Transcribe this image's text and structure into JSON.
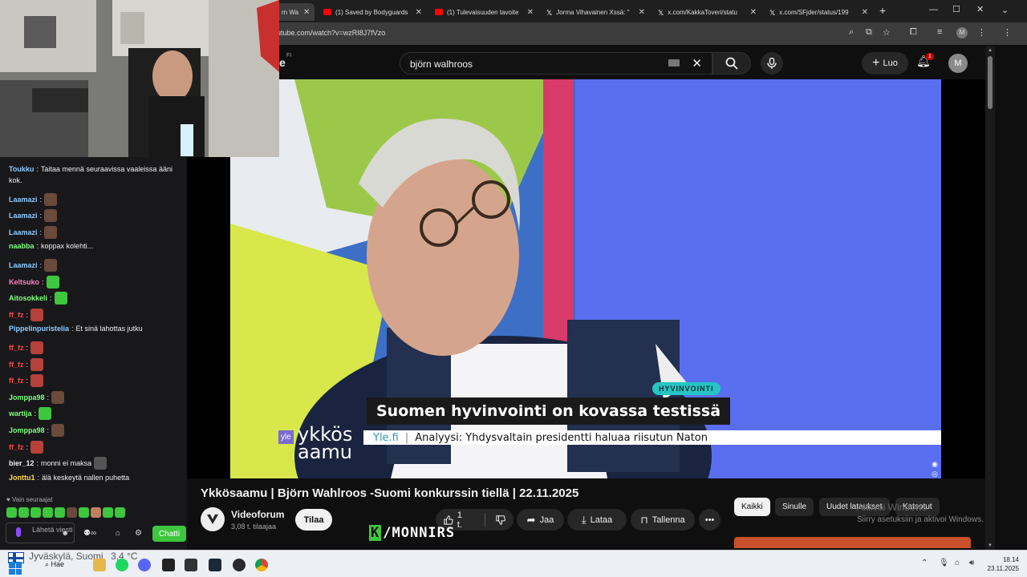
{
  "browser": {
    "tabs": [
      {
        "label": "rn Wa",
        "active": true,
        "color": "#ff0000"
      },
      {
        "label": "(1) Saved by Bodyguards",
        "color": "#ff0000"
      },
      {
        "label": "(1) Tulevaisuuden tavoite",
        "color": "#ff0000"
      },
      {
        "label": "Jorma Vihavainen Xssä: \"",
        "color": "#ffffff"
      },
      {
        "label": "x.com/KakkaToveri/statu",
        "color": "#ffffff"
      },
      {
        "label": "x.com/SFjder/status/199",
        "color": "#ffffff"
      }
    ],
    "new_tab": "+",
    "url": "utube.com/watch?v=wzRI8J7fVzo"
  },
  "youtube": {
    "logo_text": "e",
    "logo_region": "FI",
    "search_value": "björn walhroos",
    "create_label": "Luo",
    "notification_count": "1",
    "avatar_letter": "M",
    "video": {
      "tag": "HYVINVOINTI",
      "headline": "Suomen hyvinvointi on kovassa testissä",
      "ticker_source": "Yle.fi",
      "ticker_text": "Analyysi: Yhdysvaltain presidentti haluaa riisutun Naton",
      "brand_small": "yle",
      "brand_line1": "ykkös",
      "brand_line2": "aamu"
    },
    "title": "Ykkösaamu | Björn Wahlroos -Suomi konkurssin tiellä | 22.11.2025",
    "channel": {
      "name": "Videoforum",
      "subscribers": "3,08 t. tilaajaa",
      "subscribe_label": "Tilaa"
    },
    "actions": {
      "likes": "1 t.",
      "share": "Jaa",
      "download": "Lataa",
      "save": "Tallenna"
    },
    "chips": [
      "Kaikki",
      "Sinulle",
      "Uudet lataukset",
      "Katsotut"
    ],
    "watermark_line1": "Aktivoi Windows",
    "watermark_line2": "Siirry asetuksiin ja aktivoi Windows."
  },
  "overlay": {
    "brand": "/MONNIRS",
    "brand_k": "K"
  },
  "chat": {
    "mode": "Vain seuraajat",
    "send_placeholder": "Lähetä viesti",
    "chat_button": "Chatti",
    "messages": [
      {
        "user": "Toukku",
        "color": "#8ecbff",
        "text": "Taitaa mennä seuraavissa vaaleissa ääni",
        "emote": null
      },
      {
        "user": "",
        "color": "#efeff1",
        "text": "kok.",
        "emote": null
      },
      {
        "user": "Laamazi",
        "color": "#8ecbff",
        "text": "",
        "emote": "#6a4a3a"
      },
      {
        "user": "Laamazi",
        "color": "#8ecbff",
        "text": "",
        "emote": "#6a4a3a"
      },
      {
        "user": "Laamazi",
        "color": "#8ecbff",
        "text": "",
        "emote": "#6a4a3a"
      },
      {
        "user": "naabba",
        "color": "#7fff7f",
        "text": "koppax kolehti...",
        "emote": null
      },
      {
        "user": "Laamazi",
        "color": "#8ecbff",
        "text": "",
        "emote": "#6a4a3a"
      },
      {
        "user": "Keltsuko",
        "color": "#ff7fbf",
        "text": "",
        "emote": "#3ec63e"
      },
      {
        "user": "Aitosokkeli",
        "color": "#7fff7f",
        "text": "",
        "emote": "#3ec63e"
      },
      {
        "user": "ff_fz",
        "color": "#ff4a4a",
        "text": "",
        "emote": "#b5413a"
      },
      {
        "user": "Pippelinpuristelia",
        "color": "#8ecbff",
        "text": "Et sinä lahottas jutku",
        "emote": null
      },
      {
        "user": "ff_fz",
        "color": "#ff4a4a",
        "text": "",
        "emote": "#b5413a"
      },
      {
        "user": "ff_fz",
        "color": "#ff4a4a",
        "text": "",
        "emote": "#b5413a"
      },
      {
        "user": "ff_fz",
        "color": "#ff4a4a",
        "text": "",
        "emote": "#b5413a"
      },
      {
        "user": "Jomppa98",
        "color": "#7fff7f",
        "text": "",
        "emote": "#6a4a3a"
      },
      {
        "user": "wartija",
        "color": "#7fff7f",
        "text": "",
        "emote": "#3ec63e"
      },
      {
        "user": "Jomppa98",
        "color": "#7fff7f",
        "text": "",
        "emote": "#6a4a3a"
      },
      {
        "user": "ff_fz",
        "color": "#ff4a4a",
        "text": "",
        "emote": "#b5413a"
      },
      {
        "user": "bier_12",
        "color": "#efeff1",
        "text": "monni ei maksa",
        "emote": "#555555"
      },
      {
        "user": "Jonttu1",
        "color": "#ffd84a",
        "text": "älä keskeytä nallen puhetta",
        "emote": null
      }
    ]
  },
  "taskbar": {
    "weather_city": "Jyväskylä, Suomi",
    "weather_temp": "3,4 °C",
    "search_label": "Hae",
    "time": "18.14",
    "date": "23.11.2025",
    "temp_right": "18.14"
  }
}
